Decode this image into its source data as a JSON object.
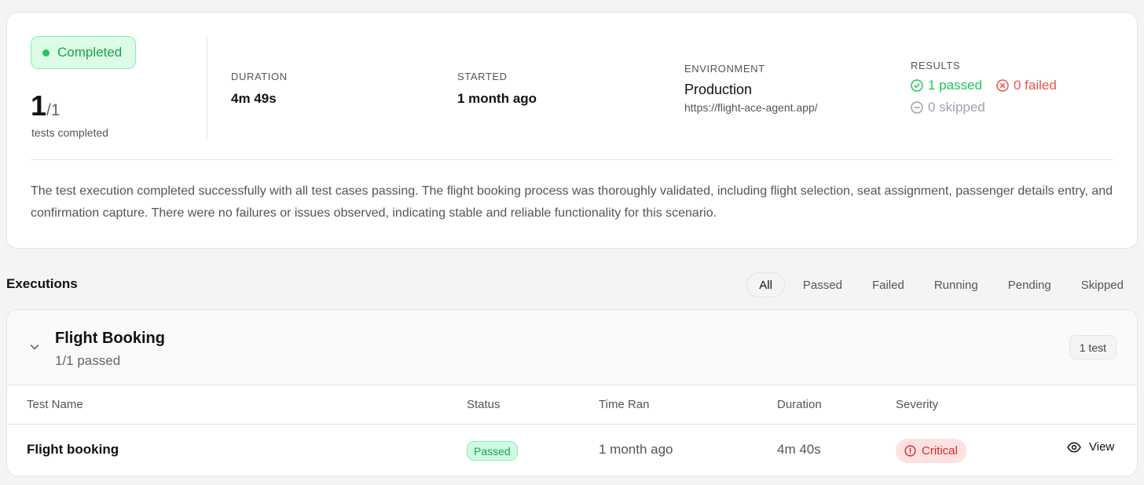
{
  "summary": {
    "status": "Completed",
    "tests_done": "1",
    "tests_total": "/1",
    "tests_caption": "tests completed",
    "duration_label": "DURATION",
    "duration_value": "4m 49s",
    "started_label": "STARTED",
    "started_value": "1 month ago",
    "environment_label": "ENVIRONMENT",
    "environment_value": "Production",
    "environment_url": "https://flight-ace-agent.app/",
    "results_label": "RESULTS",
    "passed": "1 passed",
    "failed": "0 failed",
    "skipped": "0 skipped",
    "description": "The test execution completed successfully with all test cases passing. The flight booking process was thoroughly validated, including flight selection, seat assignment, passenger details entry, and confirmation capture. There were no failures or issues observed, indicating stable and reliable functionality for this scenario."
  },
  "executions": {
    "title": "Executions",
    "filters": [
      "All",
      "Passed",
      "Failed",
      "Running",
      "Pending",
      "Skipped"
    ],
    "active_filter": "All"
  },
  "group": {
    "name": "Flight Booking",
    "subtitle": "1/1 passed",
    "count_badge": "1 test",
    "columns": [
      "Test Name",
      "Status",
      "Time Ran",
      "Duration",
      "Severity"
    ],
    "rows": [
      {
        "name": "Flight booking",
        "status": "Passed",
        "time_ran": "1 month ago",
        "duration": "4m 40s",
        "severity": "Critical",
        "action": "View"
      }
    ]
  },
  "colors": {
    "success": "#22c55e",
    "danger": "#f05252",
    "muted": "#9ca3af",
    "card_border": "#e4e4e7"
  },
  "icons": [
    "status-dot-icon",
    "check-circle-icon",
    "x-circle-icon",
    "minus-circle-icon",
    "chevron-down-icon",
    "alert-circle-icon",
    "eye-icon"
  ]
}
